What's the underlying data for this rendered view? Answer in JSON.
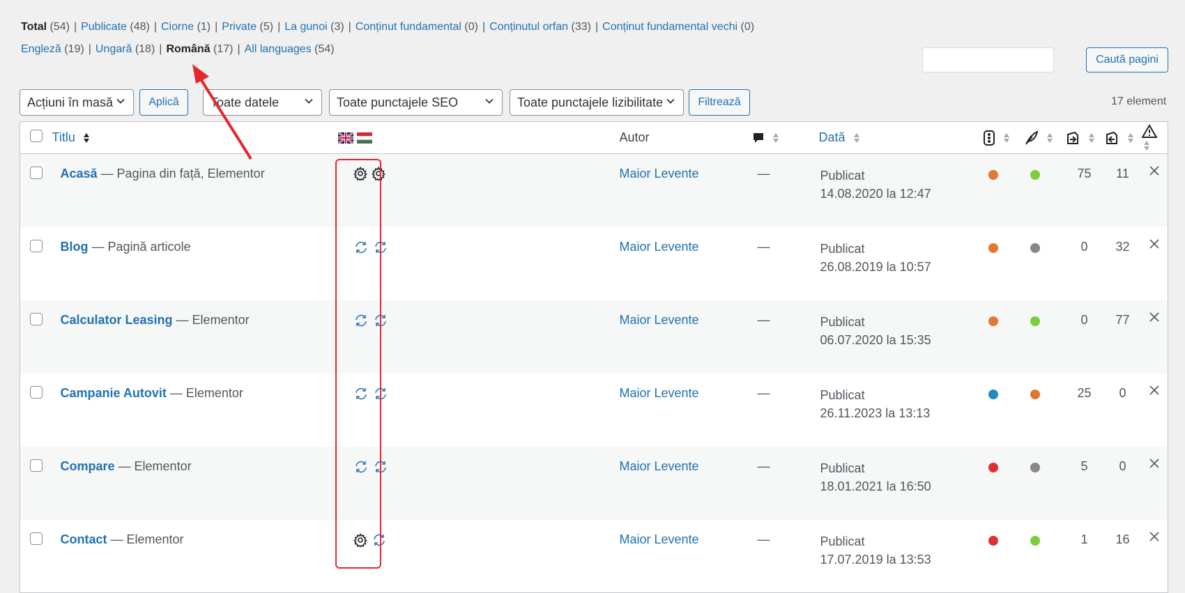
{
  "views": {
    "status": [
      {
        "label": "Total",
        "count": "(54)",
        "current": true
      },
      {
        "label": "Publicate",
        "count": "(48)"
      },
      {
        "label": "Ciorne",
        "count": "(1)"
      },
      {
        "label": "Private",
        "count": "(5)"
      },
      {
        "label": "La gunoi",
        "count": "(3)"
      },
      {
        "label": "Conținut fundamental",
        "count": "(0)"
      },
      {
        "label": "Conținutul orfan",
        "count": "(33)"
      },
      {
        "label": "Conținut fundamental vechi",
        "count": "(0)"
      }
    ],
    "languages": [
      {
        "label": "Engleză",
        "count": "(19)"
      },
      {
        "label": "Ungară",
        "count": "(18)"
      },
      {
        "label": "Română",
        "count": "(17)",
        "current": true
      },
      {
        "label": "All languages",
        "count": "(54)"
      }
    ]
  },
  "search": {
    "button": "Caută pagini",
    "value": ""
  },
  "filters": {
    "bulk_actions": "Acțiuni în masă",
    "apply": "Aplică",
    "dates": "Toate datele",
    "seo": "Toate punctajele SEO",
    "readability": "Toate punctajele lizibilitate",
    "filter": "Filtrează",
    "items_count": "17 element"
  },
  "columns": {
    "title": "Titlu",
    "author": "Autor",
    "date": "Dată"
  },
  "colors": {
    "orange": "#e27730",
    "green": "#7ad03a",
    "gray": "#888888",
    "blue": "#1e8cbe",
    "red": "#dc3232",
    "link": "#2271b1",
    "highlight": "#e8262d"
  },
  "rows": [
    {
      "title": "Acasă",
      "state": " — Pagina din față, Elementor",
      "lang": [
        "gear-icon",
        "gear-icon"
      ],
      "author": "Maior Levente",
      "comments": "—",
      "status": "Publicat",
      "date": "14.08.2020 la 12:47",
      "seo": "orange",
      "read": "green",
      "links_out": "75",
      "links_in": "11"
    },
    {
      "title": "Blog",
      "state": " — Pagină articole",
      "lang": [
        "sync-icon",
        "sync-icon"
      ],
      "author": "Maior Levente",
      "comments": "—",
      "status": "Publicat",
      "date": "26.08.2019 la 10:57",
      "seo": "orange",
      "read": "gray",
      "links_out": "0",
      "links_in": "32"
    },
    {
      "title": "Calculator Leasing",
      "state": " — Elementor",
      "lang": [
        "sync-icon",
        "sync-icon"
      ],
      "author": "Maior Levente",
      "comments": "—",
      "status": "Publicat",
      "date": "06.07.2020 la 15:35",
      "seo": "orange",
      "read": "green",
      "links_out": "0",
      "links_in": "77"
    },
    {
      "title": "Campanie Autovit",
      "state": " — Elementor",
      "lang": [
        "sync-icon",
        "sync-icon"
      ],
      "author": "Maior Levente",
      "comments": "—",
      "status": "Publicat",
      "date": "26.11.2023 la 13:13",
      "seo": "blue",
      "read": "orange",
      "links_out": "25",
      "links_in": "0"
    },
    {
      "title": "Compare",
      "state": " — Elementor",
      "lang": [
        "sync-icon",
        "sync-icon"
      ],
      "author": "Maior Levente",
      "comments": "—",
      "status": "Publicat",
      "date": "18.01.2021 la 16:50",
      "seo": "red",
      "read": "gray",
      "links_out": "5",
      "links_in": "0"
    },
    {
      "title": "Contact",
      "state": " — Elementor",
      "lang": [
        "gear-icon",
        "sync-icon"
      ],
      "author": "Maior Levente",
      "comments": "—",
      "status": "Publicat",
      "date": "17.07.2019 la 13:53",
      "seo": "red",
      "read": "green",
      "links_out": "1",
      "links_in": "16"
    }
  ]
}
